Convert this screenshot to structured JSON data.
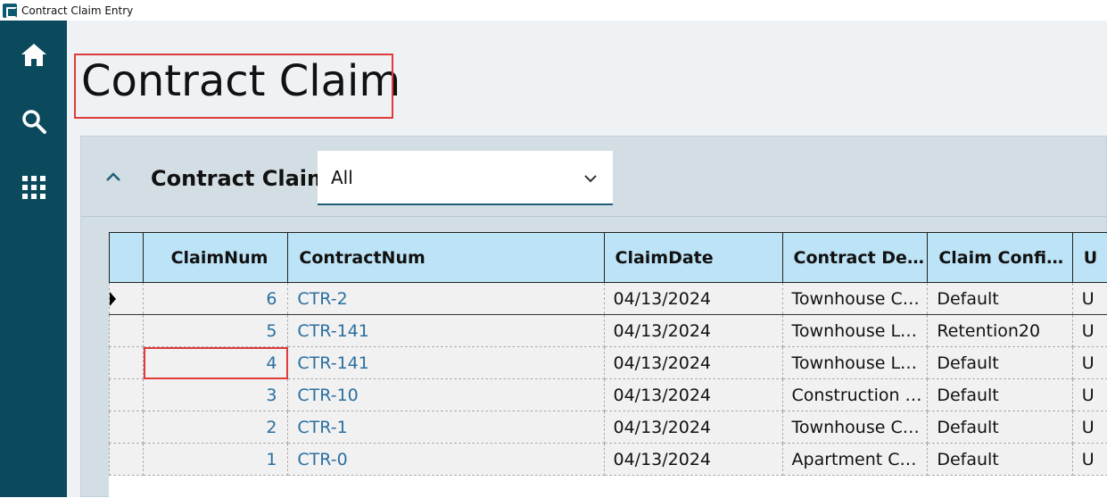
{
  "window": {
    "title": "Contract Claim Entry"
  },
  "sidebar": {
    "items": [
      {
        "icon": "home-icon"
      },
      {
        "icon": "search-icon"
      },
      {
        "icon": "apps-grid-icon"
      }
    ]
  },
  "page": {
    "title": "Contract Claim"
  },
  "panel": {
    "title": "Contract Claim",
    "filter": {
      "selected": "All"
    }
  },
  "grid": {
    "columns": [
      "ClaimNum",
      "ContractNum",
      "ClaimDate",
      "Contract De…",
      "Claim Confi…",
      "U"
    ],
    "rows": [
      {
        "claimnum": "6",
        "contractnum": "CTR-2",
        "claimdate": "04/13/2024",
        "contract_desc": "Townhouse C…",
        "claim_config": "Default",
        "extra": "U"
      },
      {
        "claimnum": "5",
        "contractnum": "CTR-141",
        "claimdate": "04/13/2024",
        "contract_desc": "Townhouse L…",
        "claim_config": "Retention20",
        "extra": "U"
      },
      {
        "claimnum": "4",
        "contractnum": "CTR-141",
        "claimdate": "04/13/2024",
        "contract_desc": "Townhouse L…",
        "claim_config": "Default",
        "extra": "U"
      },
      {
        "claimnum": "3",
        "contractnum": "CTR-10",
        "claimdate": "04/13/2024",
        "contract_desc": "Construction …",
        "claim_config": "Default",
        "extra": "U"
      },
      {
        "claimnum": "2",
        "contractnum": "CTR-1",
        "claimdate": "04/13/2024",
        "contract_desc": "Townhouse C…",
        "claim_config": "Default",
        "extra": "U"
      },
      {
        "claimnum": "1",
        "contractnum": "CTR-0",
        "claimdate": "04/13/2024",
        "contract_desc": "Apartment C…",
        "claim_config": "Default",
        "extra": "U"
      }
    ]
  },
  "colors": {
    "sidebar": "#0b4a5d",
    "header": "#bde3f7",
    "link": "#2a6fa0",
    "highlight": "#e03a3a"
  }
}
